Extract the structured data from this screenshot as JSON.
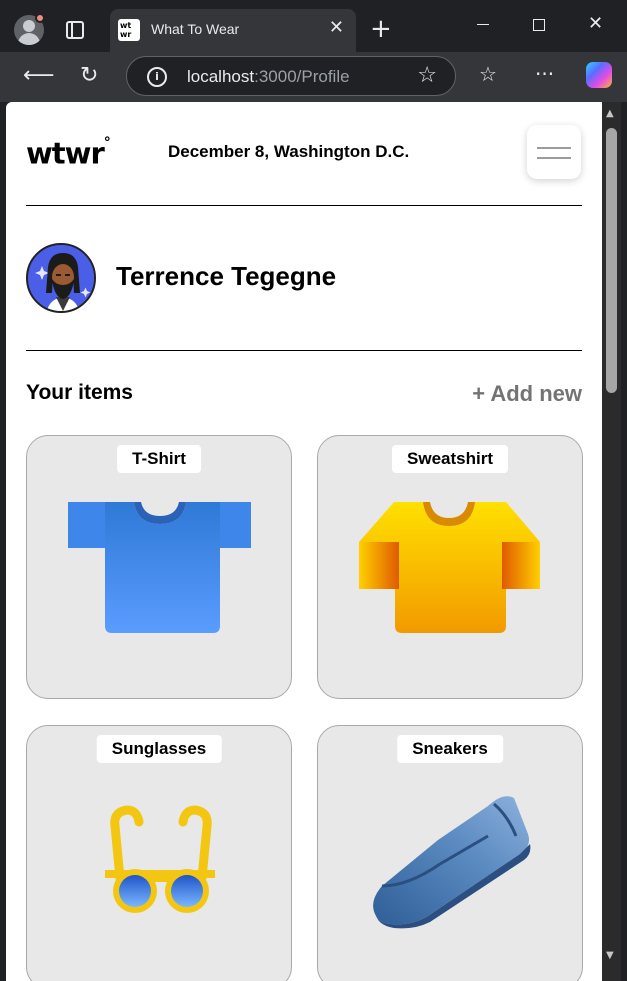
{
  "browser": {
    "tab_title": "What To Wear",
    "favicon_text": "wt wr",
    "url_host": "localhost",
    "url_path": ":3000/Profile"
  },
  "header": {
    "logo": "wtwr",
    "logo_mark": "°",
    "date_location": "December 8, Washington D.C."
  },
  "profile": {
    "name": "Terrence Tegegne"
  },
  "items_section": {
    "title": "Your items",
    "add_new": "+ Add new",
    "items": [
      {
        "label": "T-Shirt",
        "icon": "tshirt-icon",
        "color": "#4d8ef5"
      },
      {
        "label": "Sweatshirt",
        "icon": "sweatshirt-icon",
        "color": "#f5b400"
      },
      {
        "label": "Sunglasses",
        "icon": "sunglasses-icon",
        "color": "#f3c711"
      },
      {
        "label": "Sneakers",
        "icon": "sneaker-icon",
        "color": "#4b78a8"
      }
    ]
  },
  "colors": {
    "browser_bg": "#202124",
    "toolbar_bg": "#35363a",
    "card_bg": "#e8e8e8",
    "avatar_bg": "#4b5ee8",
    "add_new_gray": "#737373"
  }
}
